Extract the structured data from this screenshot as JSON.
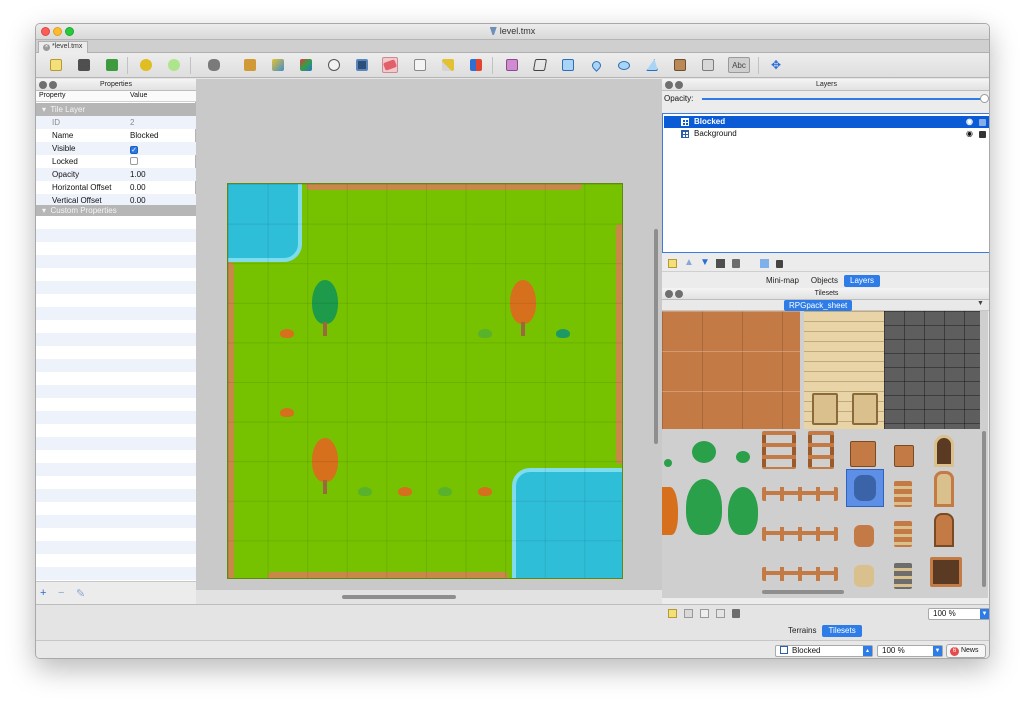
{
  "window": {
    "title": "level.tmx"
  },
  "tabs": [
    {
      "label": "*level.tmx"
    }
  ],
  "toolbar": {
    "icons": [
      "new-icon",
      "open-icon",
      "save-icon",
      "undo-icon",
      "redo-icon",
      "stamp-icon",
      "terrain-icon",
      "bucket-icon",
      "shape-fill-icon",
      "eraser-icon",
      "rectangle-select-icon",
      "magic-wand-icon",
      "select-same-icon",
      "random-icon",
      "object-select-icon",
      "edit-polygon-icon",
      "rectangle-icon",
      "point-icon",
      "ellipse-icon",
      "polygon-icon",
      "tile-object-icon",
      "template-icon",
      "text-icon",
      "move-icon"
    ],
    "active": "eraser-icon",
    "text_tool_label": "Abc"
  },
  "properties": {
    "panel_title": "Properties",
    "col_property": "Property",
    "col_value": "Value",
    "group_tile_layer": "Tile Layer",
    "rows": [
      {
        "key": "ID",
        "value": "2"
      },
      {
        "key": "Name",
        "value": "Blocked"
      },
      {
        "key": "Visible",
        "checked": true
      },
      {
        "key": "Locked",
        "checked": false
      },
      {
        "key": "Opacity",
        "value": "1.00"
      },
      {
        "key": "Horizontal Offset",
        "value": "0.00"
      },
      {
        "key": "Vertical Offset",
        "value": "0.00"
      }
    ],
    "group_custom": "Custom Properties",
    "footer": {
      "add": "+",
      "remove": "−",
      "edit": "✎"
    }
  },
  "layers": {
    "panel_title": "Layers",
    "opacity_label": "Opacity:",
    "items": [
      {
        "name": "Blocked",
        "selected": true
      },
      {
        "name": "Background",
        "selected": false
      }
    ],
    "tabs": [
      "Mini-map",
      "Objects",
      "Layers"
    ],
    "active_tab": "Layers"
  },
  "tilesets": {
    "panel_title": "Tilesets",
    "current_sheet": "RPGpack_sheet",
    "zoom": "100 %",
    "tabs": [
      "Terrains",
      "Tilesets"
    ],
    "active_tab": "Tilesets"
  },
  "status": {
    "layer": "Blocked",
    "zoom": "100 %",
    "news_label": "News",
    "news_count": "6"
  },
  "colors": {
    "grass": "#76c200",
    "water": "#2fbed8",
    "path": "#c88948",
    "accent": "#2d7ce8",
    "selection": "#0b5bd6"
  }
}
